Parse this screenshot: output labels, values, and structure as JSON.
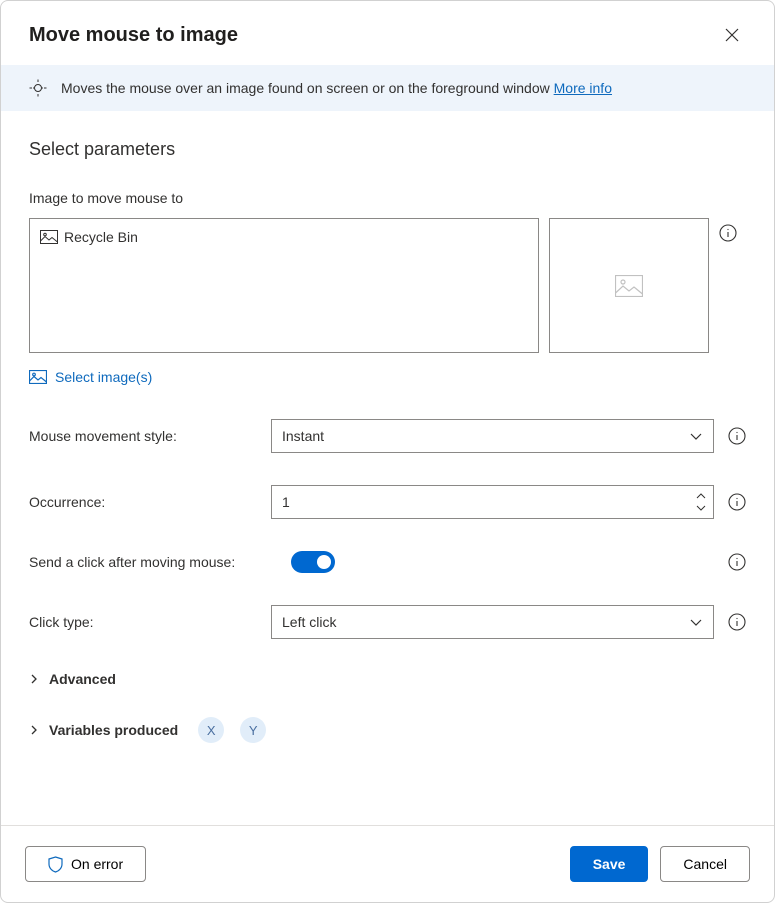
{
  "dialog": {
    "title": "Move mouse to image"
  },
  "infobar": {
    "text": "Moves the mouse over an image found on screen or on the foreground window ",
    "more_info": "More info"
  },
  "section": {
    "title": "Select parameters"
  },
  "fields": {
    "image_label": "Image to move mouse to",
    "selected_image": "Recycle Bin",
    "select_images_link": "Select image(s)",
    "movement_style_label": "Mouse movement style:",
    "movement_style_value": "Instant",
    "occurrence_label": "Occurrence:",
    "occurrence_value": "1",
    "send_click_label": "Send a click after moving mouse:",
    "click_type_label": "Click type:",
    "click_type_value": "Left click"
  },
  "collapsibles": {
    "advanced": "Advanced",
    "variables_produced": "Variables produced",
    "var1": "X",
    "var2": "Y"
  },
  "footer": {
    "on_error": "On error",
    "save": "Save",
    "cancel": "Cancel"
  }
}
